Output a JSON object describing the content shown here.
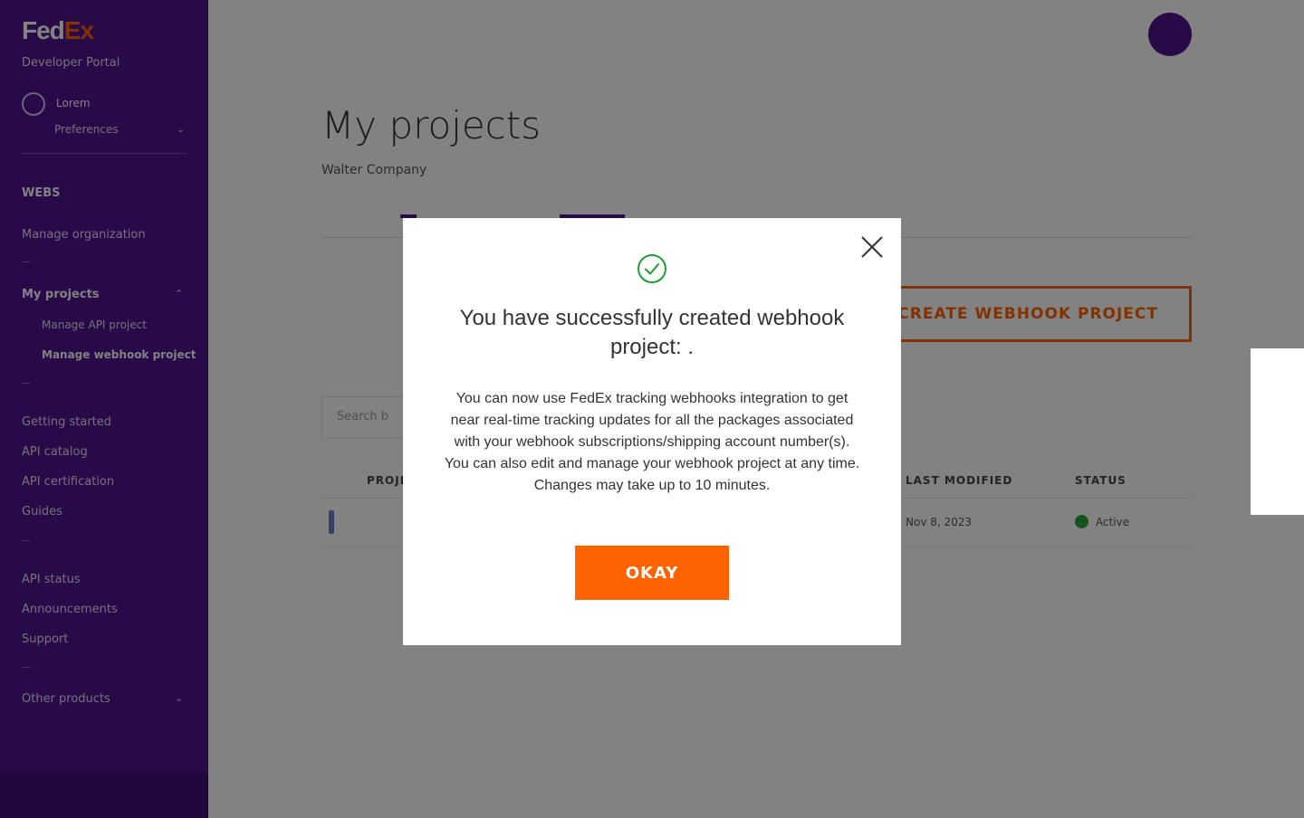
{
  "brand": {
    "logo_part1": "Fed",
    "logo_part2": "Ex",
    "portal_name": "Developer Portal"
  },
  "sidebar": {
    "user": {
      "name": "Lorem",
      "preferences_label": "Preferences"
    },
    "section_title": "WEBS",
    "items": [
      {
        "label": "Manage organization"
      },
      {
        "label": "My projects"
      },
      {
        "label": "Manage API project"
      },
      {
        "label": "Manage webhook project"
      },
      {
        "label": "Getting started"
      },
      {
        "label": "API catalog"
      },
      {
        "label": "API certification"
      },
      {
        "label": "Guides"
      },
      {
        "label": "API status"
      },
      {
        "label": "Announcements"
      },
      {
        "label": "Support"
      },
      {
        "label": "Other products"
      }
    ],
    "separator": "—"
  },
  "main": {
    "title": "My projects",
    "company": "Walter Company",
    "create_button": "CREATE WEBHOOK PROJECT",
    "search_placeholder": "Search b",
    "table": {
      "headers": [
        "PROJE",
        "LAST MODIFIED",
        "STATUS"
      ],
      "row": {
        "last_modified": "Nov 8, 2023",
        "status": "Active"
      }
    }
  },
  "modal": {
    "title": "You have successfully created webhook project: .",
    "body": "You can now use FedEx tracking webhooks integration to get near real-time tracking updates for all the packages associated with your webhook subscriptions/shipping account number(s). You can also edit and manage your webhook project at any time. Changes may take up to 10 minutes.",
    "okay_label": "OKAY"
  },
  "colors": {
    "brand_purple": "#4d148c",
    "brand_orange": "#ff6200",
    "success_green": "#2aa63d"
  },
  "icons": {
    "close": "close-icon",
    "success": "check-circle-icon"
  }
}
